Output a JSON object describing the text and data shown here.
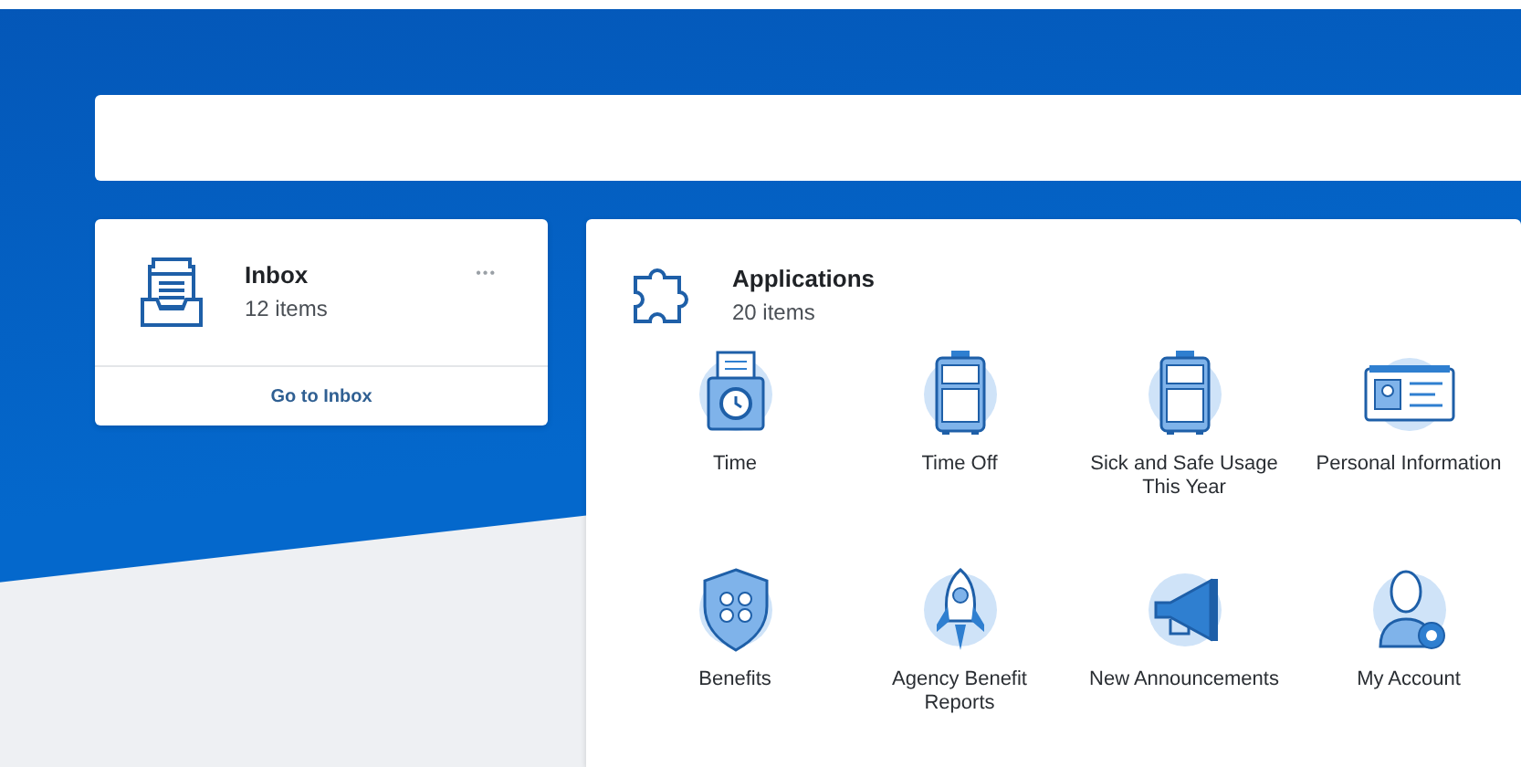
{
  "inbox": {
    "title": "Inbox",
    "count": "12 items",
    "more": "•••",
    "link": "Go to Inbox"
  },
  "applications": {
    "title": "Applications",
    "count": "20 items",
    "apps": [
      {
        "label": "Time"
      },
      {
        "label": "Time Off"
      },
      {
        "label": "Sick and Safe Usage This Year"
      },
      {
        "label": "Personal Information"
      },
      {
        "label": "Benefits"
      },
      {
        "label": "Agency Benefit Reports"
      },
      {
        "label": "New Announcements"
      },
      {
        "label": "My Account"
      }
    ]
  }
}
